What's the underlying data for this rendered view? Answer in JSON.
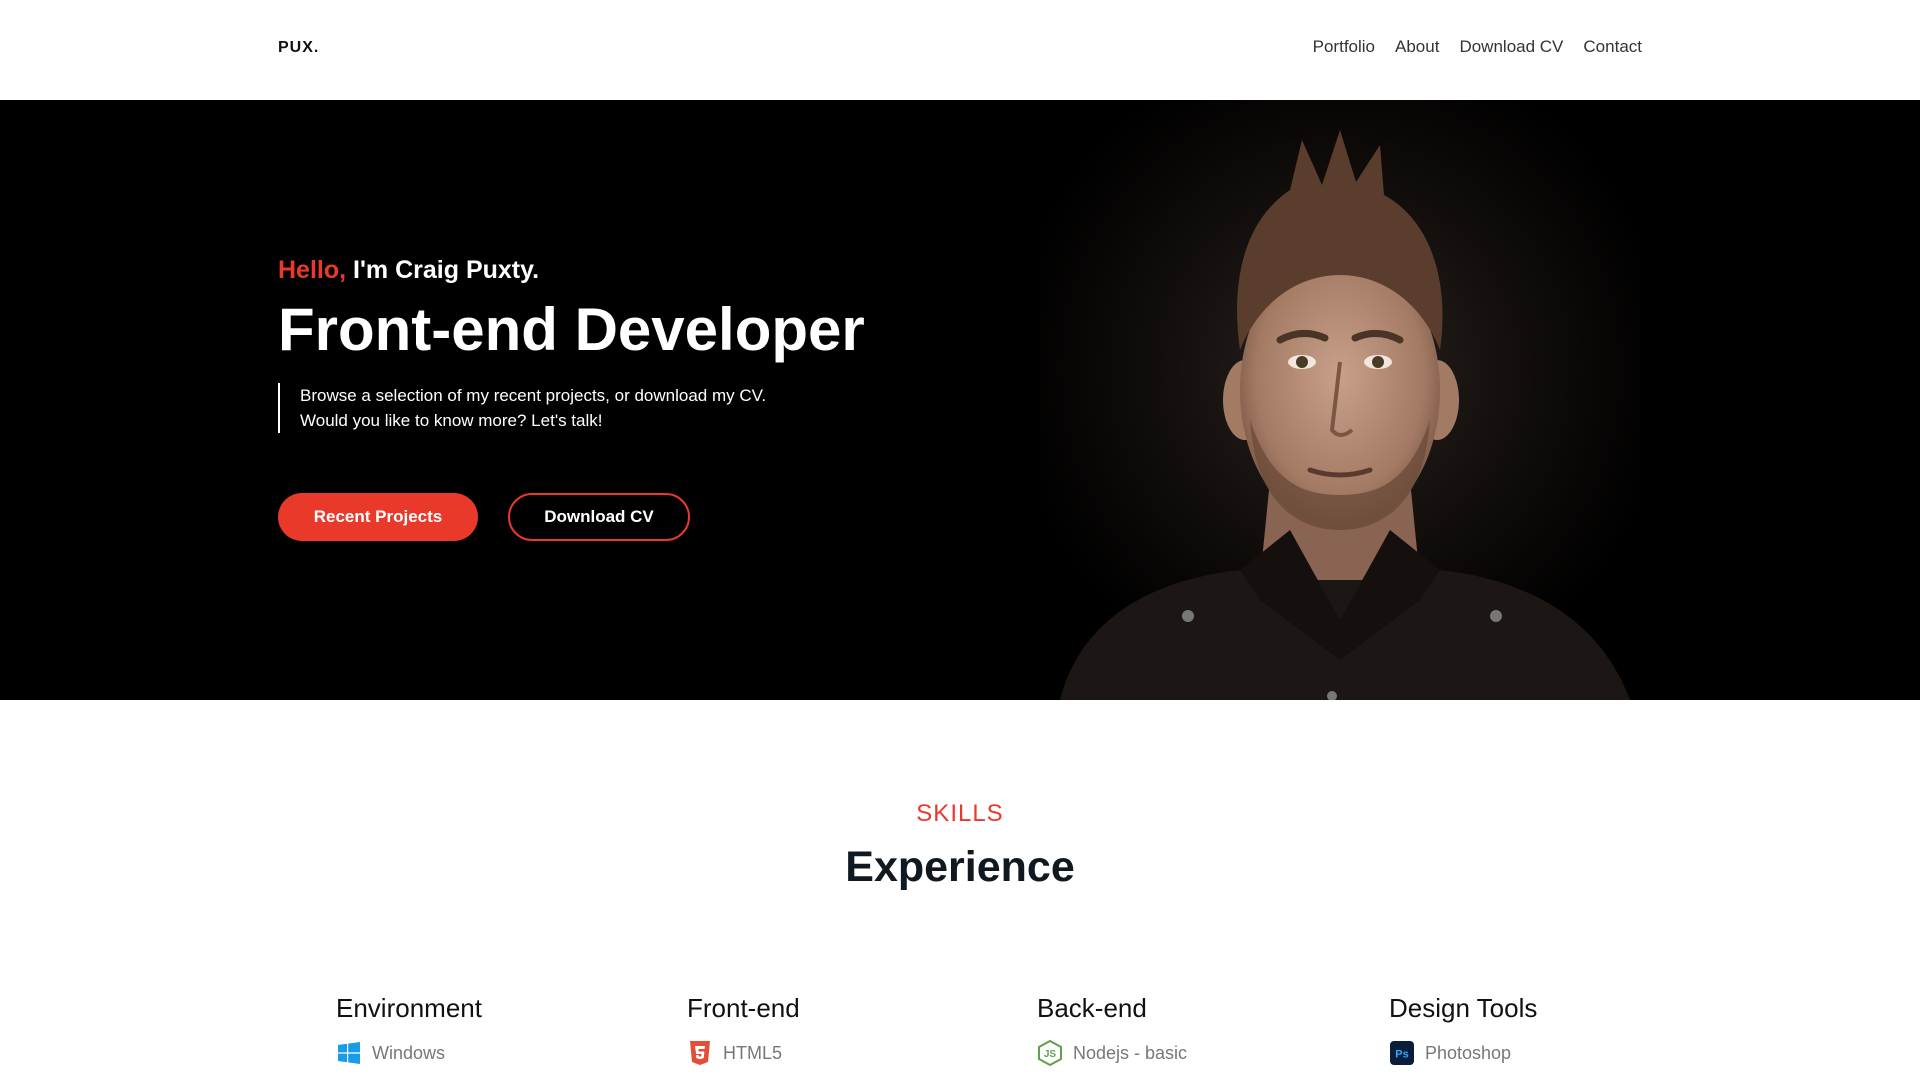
{
  "nav": {
    "logo": "PUX.",
    "links": [
      "Portfolio",
      "About",
      "Download CV",
      "Contact"
    ]
  },
  "hero": {
    "greeting_accent": "Hello,",
    "greeting_rest": " I'm Craig Puxty.",
    "title": "Front-end Developer",
    "desc_line1": "Browse a selection of my recent projects, or download my CV.",
    "desc_line2": "Would you like to know more? Let's talk!",
    "primary_button": "Recent Projects",
    "secondary_button": "Download CV"
  },
  "skills": {
    "eyebrow": "SKILLS",
    "title": "Experience",
    "columns": [
      {
        "title": "Environment",
        "item": "Windows",
        "icon": "windows-icon"
      },
      {
        "title": "Front-end",
        "item": "HTML5",
        "icon": "html5-icon"
      },
      {
        "title": "Back-end",
        "item": "Nodejs - basic",
        "icon": "nodejs-icon"
      },
      {
        "title": "Design Tools",
        "item": "Photoshop",
        "icon": "photoshop-icon"
      }
    ]
  },
  "colors": {
    "accent": "#e8392a",
    "hero_bg": "#000000",
    "heading": "#101820"
  }
}
